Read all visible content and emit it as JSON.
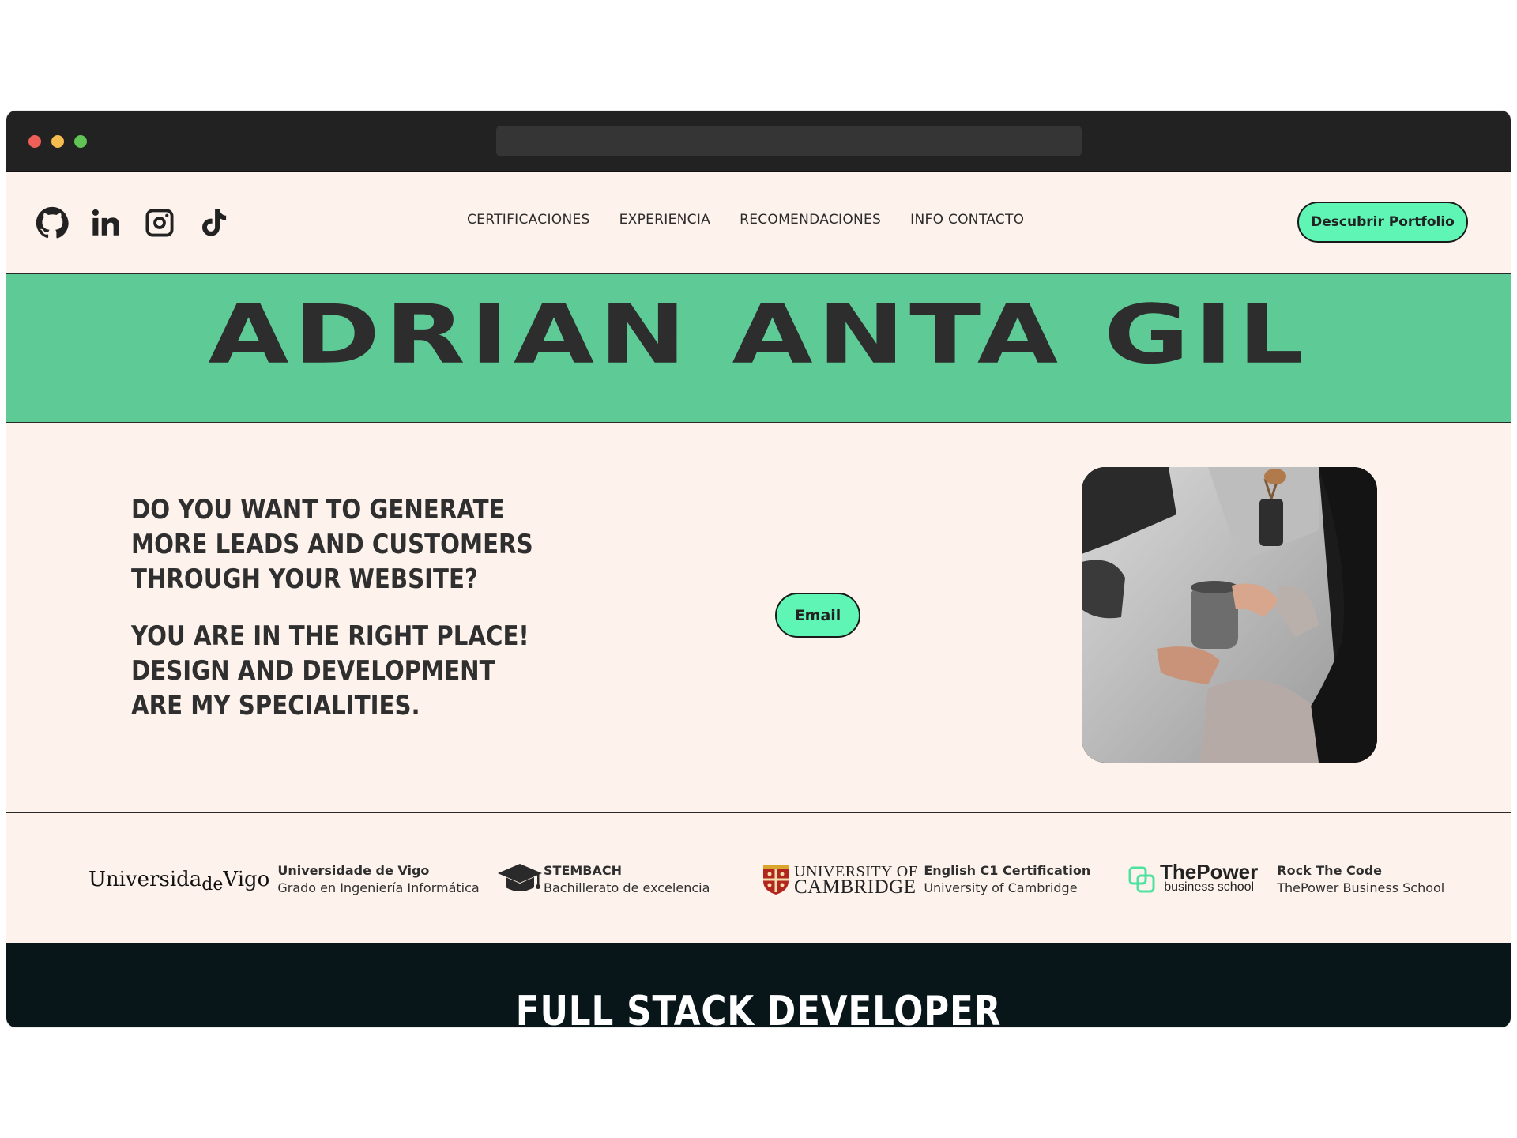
{
  "header": {
    "socials": [
      {
        "icon": "github-icon"
      },
      {
        "icon": "linkedin-icon"
      },
      {
        "icon": "instagram-icon"
      },
      {
        "icon": "tiktok-icon"
      }
    ],
    "nav": [
      "CERTIFICACIONES",
      "EXPERIENCIA",
      "RECOMENDACIONES",
      "INFO CONTACTO"
    ],
    "cta_label": "Descubrir Portfolio",
    "accent": "#5ef5b5"
  },
  "banner": {
    "name": "ADRIAN ANTA GIL",
    "background": "#5ecb97"
  },
  "hero": {
    "pitch_1": "DO YOU WANT TO GENERATE MORE LEADS AND CUSTOMERS THROUGH YOUR WEBSITE?",
    "pitch_2": "YOU ARE IN THE RIGHT PLACE! DESIGN AND DEVELOPMENT ARE MY SPECIALITIES.",
    "email_label": "Email"
  },
  "certs": [
    {
      "logo_a": "Universida",
      "logo_de": "de",
      "logo_b": "Vigo",
      "title": "Universidade de Vigo",
      "subtitle": "Grado en Ingeniería Informática"
    },
    {
      "logo_icon": "graduation-cap-icon",
      "title": "STEMBACH",
      "subtitle": "Bachillerato de excelencia"
    },
    {
      "logo_l1": "UNIVERSITY OF",
      "logo_l2": "CAMBRIDGE",
      "title": "English C1 Certification",
      "subtitle": "University of Cambridge"
    },
    {
      "logo_name": "ThePower",
      "logo_sub": "business school",
      "title": "Rock The Code",
      "subtitle": "ThePower Business School"
    }
  ],
  "footer_band": {
    "title": "FULL STACK DEVELOPER",
    "background": "#08161a"
  }
}
